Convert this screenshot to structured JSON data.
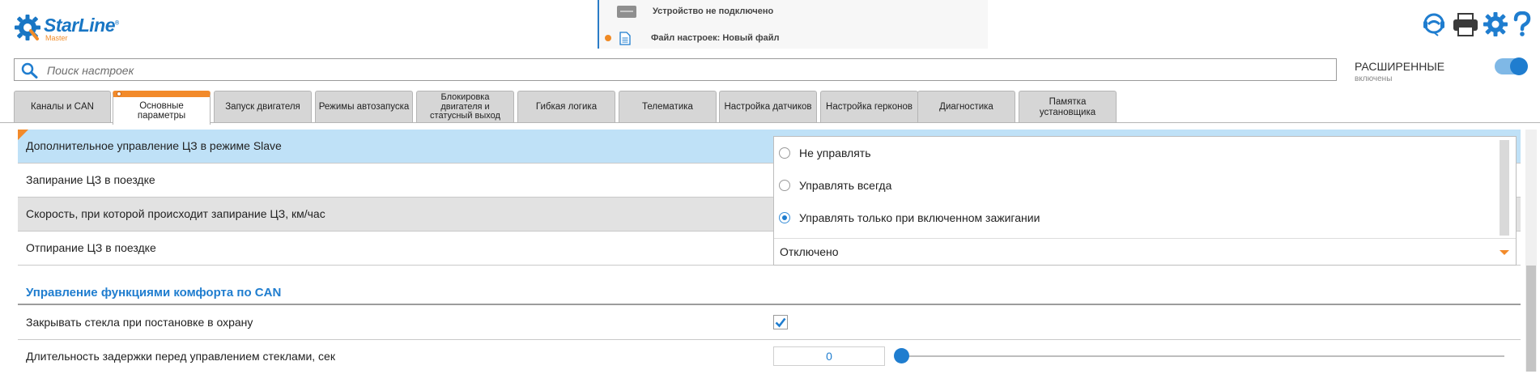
{
  "logo": {
    "brand": "StarLine",
    "registered": "®",
    "sub": "Master"
  },
  "status": {
    "device": "Устройство не подключено",
    "file": "Файл настроек: Новый файл"
  },
  "header_icons": [
    "support-icon",
    "print-icon",
    "settings-icon",
    "help-icon"
  ],
  "search": {
    "placeholder": "Поиск настроек",
    "value": ""
  },
  "advanced": {
    "title": "РАСШИРЕННЫЕ",
    "state": "включены",
    "enabled": true
  },
  "tabs": [
    {
      "label": "Каналы и CAN"
    },
    {
      "label": "Основные параметры",
      "active": true
    },
    {
      "label": "Запуск двигателя"
    },
    {
      "label": "Режимы автозапуска"
    },
    {
      "label": "Блокировка двигателя и статусный выход"
    },
    {
      "label": "Гибкая логика"
    },
    {
      "label": "Телематика"
    },
    {
      "label": "Настройка датчиков"
    },
    {
      "label": "Настройка герконов"
    },
    {
      "label": "Диагностика"
    },
    {
      "label": "Памятка установщика"
    }
  ],
  "rows": [
    {
      "label": "Дополнительное управление ЦЗ в режиме Slave"
    },
    {
      "label": "Запирание ЦЗ в поездке"
    },
    {
      "label": "Скорость, при которой происходит запирание ЦЗ, км/час"
    },
    {
      "label": "Отпирание ЦЗ в поездке"
    }
  ],
  "dropdown": {
    "options": [
      {
        "label": "Не управлять",
        "selected": false
      },
      {
        "label": "Управлять всегда",
        "selected": false
      },
      {
        "label": "Управлять только при включенном зажигании",
        "selected": true
      }
    ],
    "current_value": "Отключено"
  },
  "section": {
    "title": "Управление функциями комфорта по CAN",
    "rows": [
      {
        "label": "Закрывать стекла при постановке в охрану",
        "checked": true
      },
      {
        "label": "Длительность задержки перед управлением стеклами, сек",
        "value": "0",
        "slider_fraction": 0
      }
    ]
  },
  "colors": {
    "accent": "#1f7dcf",
    "highlight": "#f28a2a",
    "selected_row": "#bfe1f7"
  }
}
